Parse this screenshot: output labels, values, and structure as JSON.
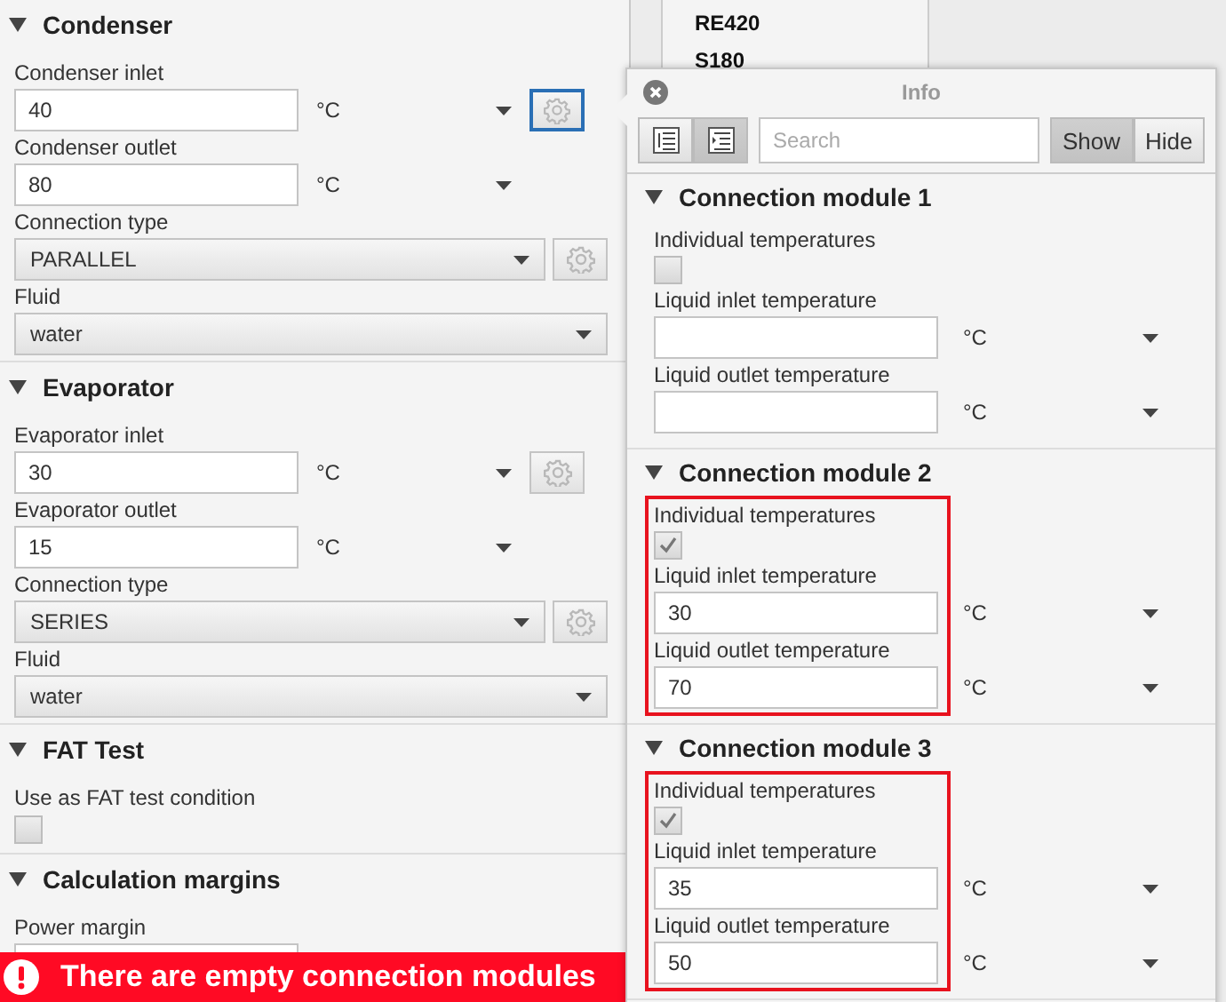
{
  "left_panel": {
    "sections": [
      {
        "title": "Condenser",
        "expanded": true,
        "items": [
          {
            "kind": "temperature",
            "label": "Condenser inlet",
            "value": "40",
            "unit": "°C",
            "gear": true,
            "focused": true
          },
          {
            "kind": "temperature",
            "label": "Condenser outlet",
            "value": "80",
            "unit": "°C",
            "gear": false
          },
          {
            "kind": "combo",
            "label": "Connection type",
            "value": "PARALLEL",
            "gear": true,
            "focused": false
          },
          {
            "kind": "combo",
            "label": "Fluid",
            "value": "water",
            "gear": false
          }
        ]
      },
      {
        "title": "Evaporator",
        "expanded": true,
        "items": [
          {
            "kind": "temperature",
            "label": "Evaporator inlet",
            "value": "30",
            "unit": "°C",
            "gear": true,
            "focused": false
          },
          {
            "kind": "temperature",
            "label": "Evaporator outlet",
            "value": "15",
            "unit": "°C",
            "gear": false
          },
          {
            "kind": "combo",
            "label": "Connection type",
            "value": "SERIES",
            "gear": true,
            "focused": false
          },
          {
            "kind": "combo",
            "label": "Fluid",
            "value": "water",
            "gear": false
          }
        ]
      },
      {
        "title": "FAT Test",
        "expanded": true,
        "items": [
          {
            "kind": "checkbox",
            "label": "Use as FAT test condition",
            "checked": false
          }
        ]
      },
      {
        "title": "Calculation margins",
        "expanded": true,
        "items": [
          {
            "kind": "field",
            "label": "Power margin"
          }
        ]
      }
    ]
  },
  "error_bar": {
    "message": "There are empty connection modules"
  },
  "model_list": {
    "items": [
      "RE420",
      "S180"
    ]
  },
  "info_popup": {
    "title": "Info",
    "view_buttons": [
      {
        "selected": false
      },
      {
        "selected": true
      }
    ],
    "search": {
      "placeholder": "Search"
    },
    "filter_buttons": [
      {
        "label": "Show",
        "selected": true
      },
      {
        "label": "Hide",
        "selected": false
      }
    ],
    "modules": [
      {
        "title": "Connection module 1",
        "expanded": true,
        "highlighted": false,
        "individual": {
          "label": "Individual temperatures",
          "checked": false
        },
        "fields": [
          {
            "label": "Liquid inlet temperature",
            "unit": "°C"
          },
          {
            "label": "Liquid outlet temperature",
            "unit": "°C"
          }
        ]
      },
      {
        "title": "Connection module 2",
        "expanded": true,
        "highlighted": true,
        "individual": {
          "label": "Individual temperatures",
          "checked": true
        },
        "fields": [
          {
            "label": "Liquid inlet temperature",
            "value": "30",
            "unit": "°C"
          },
          {
            "label": "Liquid outlet temperature",
            "value": "70",
            "unit": "°C"
          }
        ]
      },
      {
        "title": "Connection module 3",
        "expanded": true,
        "highlighted": true,
        "individual": {
          "label": "Individual temperatures",
          "checked": true
        },
        "fields": [
          {
            "label": "Liquid inlet temperature",
            "value": "35",
            "unit": "°C"
          },
          {
            "label": "Liquid outlet temperature",
            "value": "50",
            "unit": "°C"
          }
        ]
      }
    ]
  }
}
